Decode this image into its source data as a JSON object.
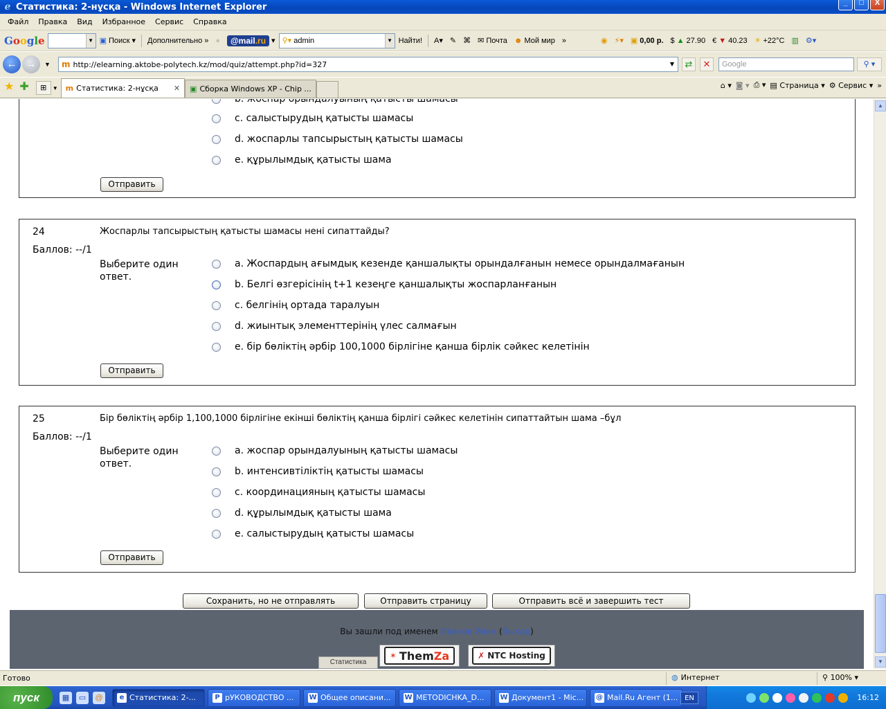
{
  "window": {
    "title": "Статистика: 2-нұсқа - Windows Internet Explorer",
    "min": "_",
    "max": "□",
    "close": "X"
  },
  "menu": [
    "Файл",
    "Правка",
    "Вид",
    "Избранное",
    "Сервис",
    "Справка"
  ],
  "google_toolbar": {
    "logo": [
      "G",
      "o",
      "o",
      "g",
      "l",
      "e"
    ],
    "search_label": "Поиск",
    "more_label": "Дополнительно",
    "mailru_left": "@mail",
    "mailru_right": ".ru",
    "user": "admin",
    "find_label": "Найти!",
    "mail_label": "Почта",
    "myworld_label": "Мой мир",
    "balance": "0,00 р.",
    "usd": "27.90",
    "eur": "40.23",
    "weather": "+22°C"
  },
  "address": {
    "url": "http://elearning.aktobe-polytech.kz/mod/quiz/attempt.php?id=327",
    "search_placeholder": "Google"
  },
  "tabs": [
    {
      "label": "Статистика: 2-нұсқа",
      "active": true
    },
    {
      "label": "Сборка Windows XP - Chip ...",
      "active": false
    }
  ],
  "command_bar": {
    "page": "Страница",
    "tools": "Сервис"
  },
  "questions": [
    {
      "id": "23",
      "partial": true,
      "answers": [
        "b. жоспар орындалуының қатысты шамасы",
        "c. салыстырудың қатысты шамасы",
        "d. жоспарлы тапсырыстың қатысты шамасы",
        "e. құрылымдық қатысты шама"
      ],
      "submit": "Отправить"
    },
    {
      "id": "24",
      "number": "24",
      "score": "Баллов: --/1",
      "text": "Жоспарлы тапсырыстың қатысты шамасы нені сипаттайды?",
      "prompt": "Выберите один ответ.",
      "answers": [
        "a. Жоспардың ағымдық кезенде қаншалықты орындалғанын немесе орындалмағанын",
        "b. Белгі өзгерісінің t+1 кезеңге қаншалықты жоспарланғанын",
        "c. белгінің ортада таралуын",
        "d. жиынтық элементтерінің үлес салмағын",
        "e. бір бөліктің әрбір 100,1000 бірлігіне қанша бірлік сәйкес келетінін"
      ],
      "submit": "Отправить"
    },
    {
      "id": "25",
      "number": "25",
      "score": "Баллов: --/1",
      "text": "Бір бөліктің әрбір 1,100,1000 бірлігіне екінші бөліктің қанша бірлігі сәйкес келетінін сипаттайтын шама –бұл",
      "prompt": "Выберите один ответ.",
      "answers": [
        "a. жоспар орындалуының қатысты шамасы",
        "b. интенсивтіліктің қатысты шамасы",
        "c. координацияның қатысты шамасы",
        "d. құрылымдық қатысты шама",
        "e. салыстырудың қатысты шамасы"
      ],
      "submit": "Отправить"
    }
  ],
  "bottom_buttons": {
    "save": "Сохранить, но не отправлять",
    "submit_page": "Отправить страницу",
    "submit_all": "Отправить всё и завершить тест"
  },
  "footer": {
    "logged_prefix": "Вы зашли под именем",
    "user_name": "Иванов Иван",
    "logout": "Выход",
    "stat_tab": "Статистика",
    "themza_a": "Them",
    "themza_b": "Za",
    "ntc": "NTC Hosting"
  },
  "status": {
    "text": "Готово",
    "zone": "Интернет",
    "zoom": "100%"
  },
  "taskbar": {
    "start": "пуск",
    "items": [
      {
        "label": "Статистика: 2-...",
        "active": true,
        "icon": "e"
      },
      {
        "label": "рУКОВОДСТВО ...",
        "active": false,
        "icon": "P"
      },
      {
        "label": "Общее описани...",
        "active": false,
        "icon": "W"
      },
      {
        "label": "METODICHKA_D...",
        "active": false,
        "icon": "W"
      },
      {
        "label": "Документ1 - Mic...",
        "active": false,
        "icon": "W"
      },
      {
        "label": "Mail.Ru Агент (1...",
        "active": false,
        "icon": "@"
      }
    ],
    "lang": "EN",
    "clock": "16:12"
  }
}
